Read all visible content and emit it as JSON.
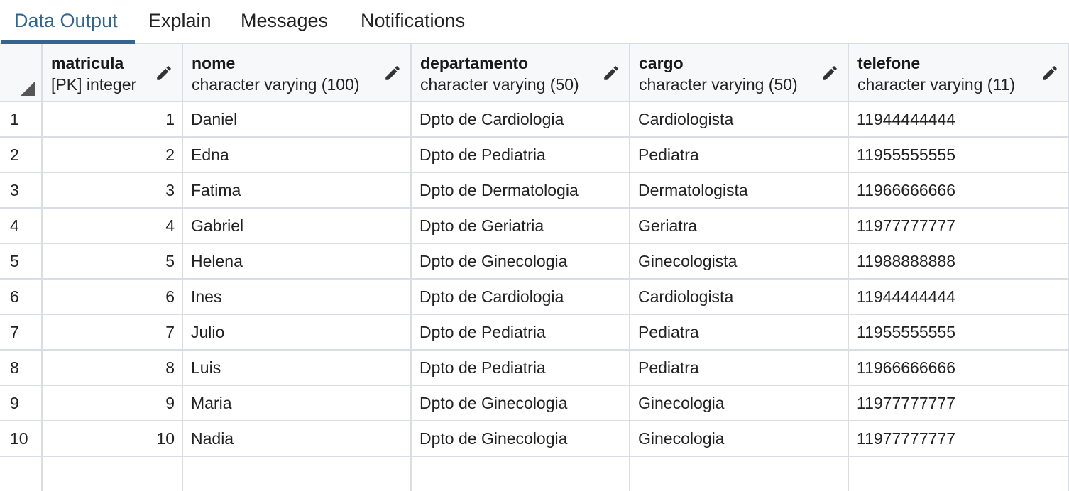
{
  "tabs": [
    {
      "label": "Data Output",
      "active": true
    },
    {
      "label": "Explain",
      "active": false
    },
    {
      "label": "Messages",
      "active": false
    },
    {
      "label": "Notifications",
      "active": false
    }
  ],
  "columns": [
    {
      "name": "matricula",
      "type": "[PK] integer"
    },
    {
      "name": "nome",
      "type": "character varying (100)"
    },
    {
      "name": "departamento",
      "type": "character varying (50)"
    },
    {
      "name": "cargo",
      "type": "character varying (50)"
    },
    {
      "name": "telefone",
      "type": "character varying (11)"
    }
  ],
  "rows": [
    {
      "n": "1",
      "matricula": "1",
      "nome": "Daniel",
      "departamento": "Dpto de Cardiologia",
      "cargo": "Cardiologista",
      "telefone": "11944444444"
    },
    {
      "n": "2",
      "matricula": "2",
      "nome": "Edna",
      "departamento": "Dpto de Pediatria",
      "cargo": "Pediatra",
      "telefone": "11955555555"
    },
    {
      "n": "3",
      "matricula": "3",
      "nome": "Fatima",
      "departamento": "Dpto de Dermatologia",
      "cargo": "Dermatologista",
      "telefone": "11966666666"
    },
    {
      "n": "4",
      "matricula": "4",
      "nome": "Gabriel",
      "departamento": "Dpto de Geriatria",
      "cargo": "Geriatra",
      "telefone": "11977777777"
    },
    {
      "n": "5",
      "matricula": "5",
      "nome": "Helena",
      "departamento": "Dpto de Ginecologia",
      "cargo": "Ginecologista",
      "telefone": "11988888888"
    },
    {
      "n": "6",
      "matricula": "6",
      "nome": "Ines",
      "departamento": "Dpto de Cardiologia",
      "cargo": "Cardiologista",
      "telefone": "11944444444"
    },
    {
      "n": "7",
      "matricula": "7",
      "nome": "Julio",
      "departamento": "Dpto de Pediatria",
      "cargo": "Pediatra",
      "telefone": "11955555555"
    },
    {
      "n": "8",
      "matricula": "8",
      "nome": "Luis",
      "departamento": "Dpto de Pediatria",
      "cargo": "Pediatra",
      "telefone": "11966666666"
    },
    {
      "n": "9",
      "matricula": "9",
      "nome": "Maria",
      "departamento": "Dpto de Ginecologia",
      "cargo": "Ginecologia",
      "telefone": "11977777777"
    },
    {
      "n": "10",
      "matricula": "10",
      "nome": "Nadia",
      "departamento": "Dpto de Ginecologia",
      "cargo": "Ginecologia",
      "telefone": "11977777777"
    }
  ],
  "icons": {
    "edit": "pencil-icon",
    "select_all": "corner-triangle-icon"
  },
  "colors": {
    "accent": "#326690",
    "grid_line": "#dadde3",
    "header_bg": "#f7f8fa"
  }
}
